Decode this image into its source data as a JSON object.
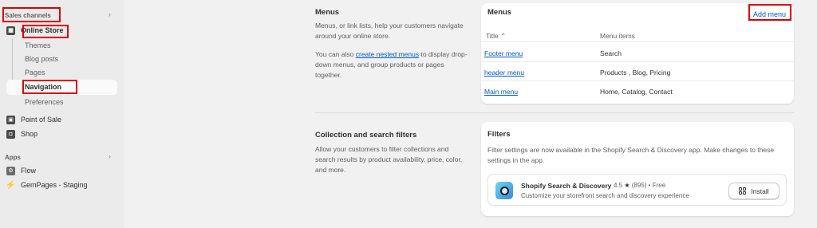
{
  "sidebar": {
    "sales_channels_label": "Sales channels",
    "online_store": "Online Store",
    "sub_items": [
      "Themes",
      "Blog posts",
      "Pages",
      "Navigation",
      "Preferences"
    ],
    "point_of_sale": "Point of Sale",
    "shop": "Shop",
    "apps_label": "Apps",
    "flow": "Flow",
    "gempages": "GemPages - Staging",
    "chevron": "›"
  },
  "menus_section": {
    "title": "Menus",
    "desc1": "Menus, or link lists, help your customers navigate around your online store.",
    "desc2_before": "You can also ",
    "desc2_link": "create nested menus",
    "desc2_after": " to display drop-down menus, and group products or pages together."
  },
  "menus_card": {
    "title": "Menus",
    "add_label": "Add menu",
    "col_title": "Title",
    "sort_icon": "⌃",
    "col_items": "Menu items",
    "rows": [
      {
        "title": "Footer menu",
        "items": "Search"
      },
      {
        "title": "header menu",
        "items": "Products , Blog, Pricing"
      },
      {
        "title": "Main menu",
        "items": "Home, Catalog, Contact"
      }
    ]
  },
  "filters_section": {
    "title": "Collection and search filters",
    "desc": "Allow your customers to filter collections and search results by product availability, price, color, and more."
  },
  "filters_card": {
    "title": "Filters",
    "desc": "Filter settings are now available in the Shopify Search & Discovery app. Make changes to these settings in the app.",
    "app_name": "Shopify Search & Discovery",
    "rating": "4.5",
    "star": "★",
    "reviews": "(895) • Free",
    "app_desc": "Customize your storefront search and discovery experience",
    "install_label": "Install"
  }
}
